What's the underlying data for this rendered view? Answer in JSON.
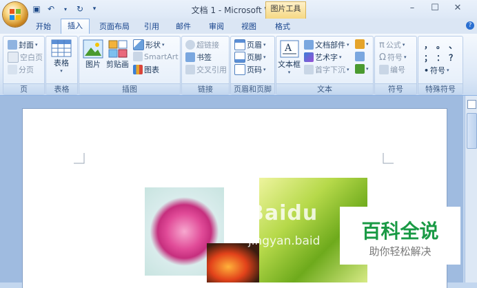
{
  "window": {
    "title": "文档 1 - Microsoft Word",
    "context_tab": "图片工具"
  },
  "tabs": [
    "开始",
    "插入",
    "页面布局",
    "引用",
    "邮件",
    "审阅",
    "视图",
    "格式"
  ],
  "groups": {
    "page": {
      "label": "页",
      "items": [
        "封面",
        "空白页",
        "分页"
      ]
    },
    "table": {
      "label": "表格",
      "button": "表格"
    },
    "illustrations": {
      "label": "插图",
      "picture": "图片",
      "clipart": "剪贴画",
      "shapes": "形状",
      "smartart": "SmartArt",
      "chart": "图表"
    },
    "links": {
      "label": "链接",
      "items": [
        "超链接",
        "书签",
        "交叉引用"
      ]
    },
    "header_footer": {
      "label": "页眉和页脚",
      "items": [
        "页眉",
        "页脚",
        "页码"
      ]
    },
    "text": {
      "label": "文本",
      "textbox": "文本框",
      "items": [
        "文档部件",
        "艺术字",
        "首字下沉"
      ]
    },
    "symbols": {
      "label": "符号",
      "items": [
        "公式",
        "符号",
        "编号"
      ]
    },
    "special": {
      "label": "特殊符号",
      "row1": [
        "，",
        "。",
        "、"
      ],
      "row2": [
        "；",
        "：",
        "？"
      ],
      "symbol_btn": "符号"
    }
  },
  "watermark": {
    "main": "Baidu",
    "url": "jingyan.baid"
  },
  "badge": {
    "title": "百科全说",
    "subtitle": "助你轻松解决"
  }
}
